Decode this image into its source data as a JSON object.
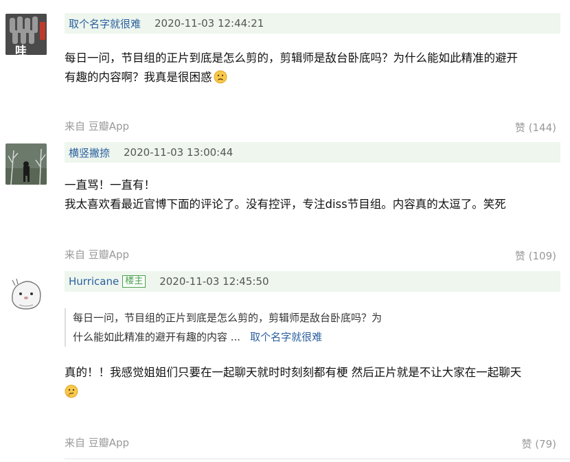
{
  "comments": [
    {
      "author": "取个名字就很难",
      "time": "2020-11-03 12:44:21",
      "avatar_label": "哇",
      "text_line1": "每日一问，节目组的正片到底是怎么剪的，剪辑师是敌台卧底吗？为什么能如此精准的避开",
      "text_line2": "有趣的内容啊？我真是很困惑",
      "source": "来自 豆瓣App",
      "likes": "赞 (144)",
      "emoji": "sad-face-icon"
    },
    {
      "author": "横竖撇捺",
      "time": "2020-11-03 13:00:44",
      "text_line1": "一直骂！一直有！",
      "text_line2": "我太喜欢看最近官博下面的评论了。没有控评，专注diss节目组。内容真的太逗了。笑死",
      "source": "来自 豆瓣App",
      "likes": "赞 (109)"
    },
    {
      "author": "Hurricane",
      "badge": "楼主",
      "time": "2020-11-03 12:45:50",
      "quote_line1": "每日一问，节目组的正片到底是怎么剪的，剪辑师是敌台卧底吗？为",
      "quote_line2": "什么能如此精准的避开有趣的内容 ...",
      "quote_author": "取个名字就很难",
      "text_line1": "真的！！我感觉姐姐们只要在一起聊天就时时刻刻都有梗 然后正片就是不让大家在一起聊天",
      "source": "来自 豆瓣App",
      "likes": "赞 (79)",
      "emoji": "thinking-face-icon"
    }
  ],
  "colors": {
    "header_bg": "#eef6ee",
    "author": "#2a5f9e",
    "badge": "#45a04a",
    "muted": "#999999"
  }
}
